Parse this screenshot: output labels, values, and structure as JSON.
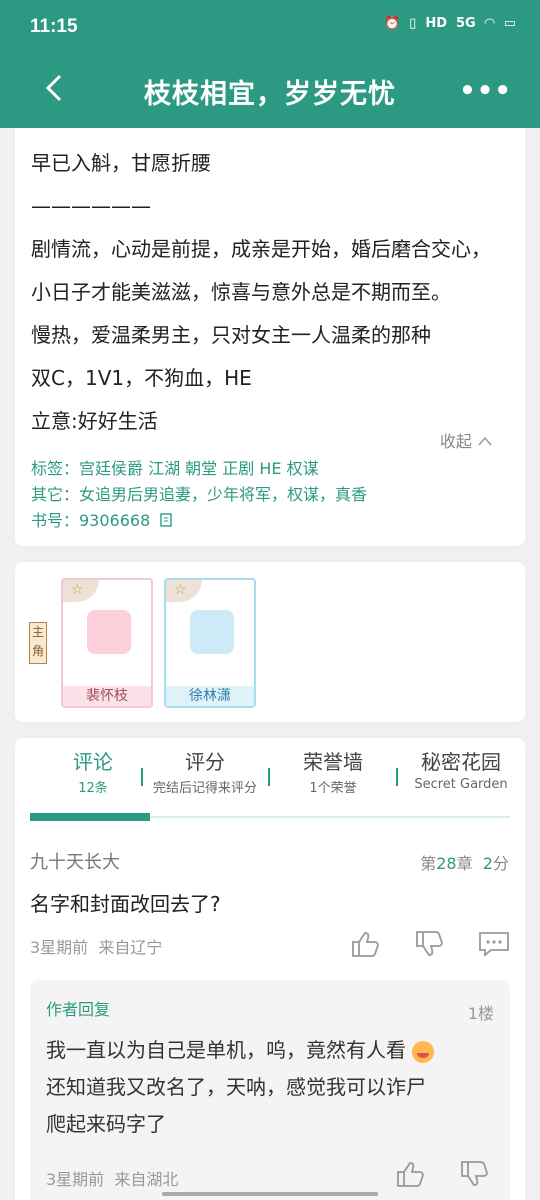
{
  "status": {
    "time": "11:15",
    "icons": [
      "alarm-icon",
      "vibrate-icon",
      "hd-icon",
      "5g-signal-icon",
      "wifi-icon",
      "battery-icon"
    ],
    "hd": "HD",
    "net": "5G"
  },
  "header": {
    "title": "枝枝相宜，岁岁无忧",
    "more": "•••"
  },
  "intro": {
    "lines": [
      "早已入斛，甘愿折腰",
      "——————",
      "剧情流，心动是前提，成亲是开始，婚后磨合交心，",
      "小日子才能美滋滋，惊喜与意外总是不期而至。",
      "慢热，爱温柔男主，只对女主一人温柔的那种",
      "双C，1V1，不狗血，HE",
      "立意:好好生活"
    ],
    "collapse": "收起",
    "tags": "标签：宫廷侯爵 江湖 朝堂 正剧 HE 权谋",
    "other": "其它：女追男后男追妻，少年将军，权谋，真香",
    "book_no": "书号：9306668"
  },
  "roles": {
    "tag": "主角",
    "characters": [
      {
        "name": "裴怀枝"
      },
      {
        "name": "徐林潇"
      }
    ]
  },
  "tabs": [
    {
      "title": "评论",
      "sub": "12条"
    },
    {
      "title": "评分",
      "sub": "完结后记得来评分"
    },
    {
      "title": "荣誉墙",
      "sub": "1个荣誉"
    },
    {
      "title": "秘密花园",
      "sub": "Secret Garden"
    }
  ],
  "comment": {
    "user": "九十天长大",
    "chapter_pre": "第",
    "chapter_no": "28",
    "chapter_suf": "章",
    "score_no": "2",
    "score_suf": "分",
    "text": "名字和封面改回去了?",
    "time": "3星期前",
    "location": "来自辽宁"
  },
  "reply": {
    "label": "作者回复",
    "floor": "1楼",
    "line1": "我一直以为自己是单机，呜，竟然有人看",
    "line2": "还知道我又改名了，天呐，感觉我可以诈尸",
    "line3": "爬起来码字了",
    "time": "3星期前",
    "location": "来自湖北"
  }
}
